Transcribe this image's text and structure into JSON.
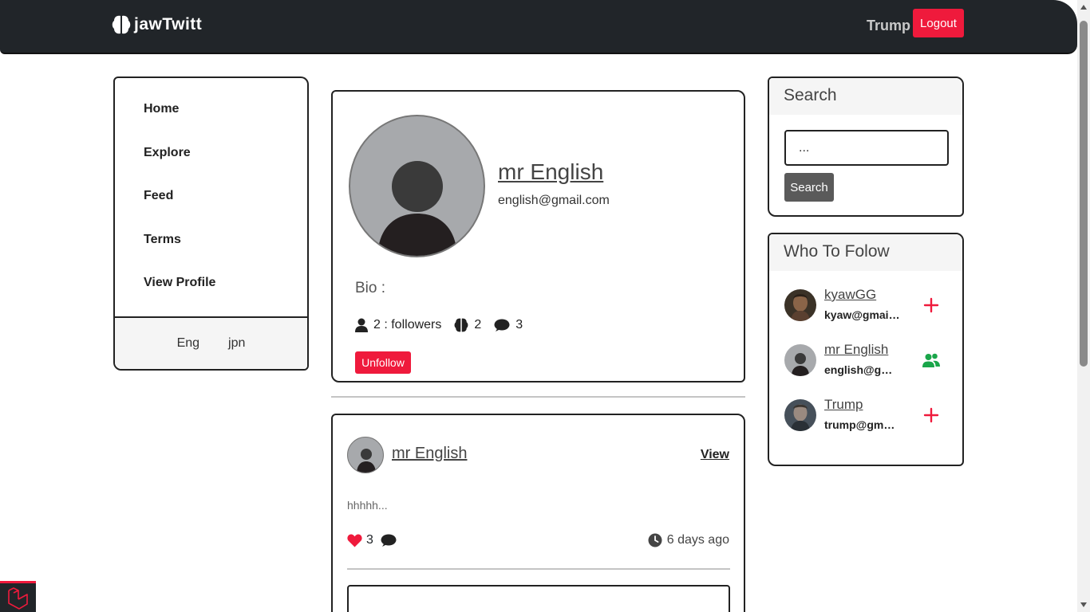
{
  "navbar": {
    "brand": "jawTwitt",
    "user": "Trump",
    "logout_label": "Logout"
  },
  "sidebar": {
    "items": [
      {
        "label": "Home"
      },
      {
        "label": "Explore"
      },
      {
        "label": "Feed"
      },
      {
        "label": "Terms"
      },
      {
        "label": "View Profile"
      }
    ],
    "languages": [
      "Eng",
      "jpn"
    ]
  },
  "profile": {
    "name": "mr English",
    "email": "english@gmail.com",
    "bio_label": "Bio :",
    "followers_text": "2 : followers",
    "posts_count": "2",
    "comments_count": "3",
    "unfollow_label": "Unfollow"
  },
  "post": {
    "author": "mr English",
    "view_label": "View",
    "text": "hhhhh...",
    "likes": "3",
    "time": "6 days ago"
  },
  "search": {
    "title": "Search",
    "input_value": "...",
    "button_label": "Search"
  },
  "who_to_follow": {
    "title": "Who To Folow",
    "users": [
      {
        "name": "kyawGG",
        "email": "kyaw@gmail.com",
        "action": "follow-plus-icon"
      },
      {
        "name": "mr English",
        "email": "english@gmail.com",
        "action": "following-users-icon"
      },
      {
        "name": "Trump",
        "email": "trump@gmail.com",
        "action": "follow-plus-icon"
      }
    ]
  },
  "colors": {
    "navbar": "#212529",
    "accent_red": "#ef1a3c",
    "following_green": "#1aa64a",
    "avatar_placeholder": "#a7a9ac"
  }
}
